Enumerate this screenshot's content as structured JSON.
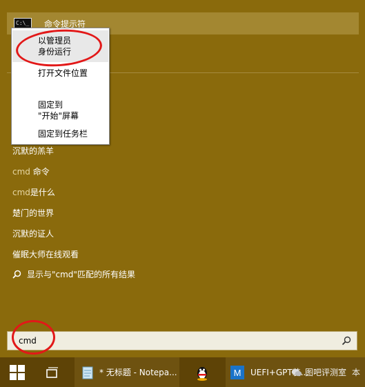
{
  "start_panel": {
    "top_result": {
      "label": "命令提示符",
      "icon_text": "C:\\_"
    },
    "results": [
      {
        "label": "沉默的羔羊"
      },
      {
        "prefix": "cmd",
        "label": " 命令"
      },
      {
        "prefix": "cmd",
        "label": "是什么"
      },
      {
        "label": "楚门的世界"
      },
      {
        "label": "沉默的证人"
      },
      {
        "label": "催眠大师在线观看"
      }
    ],
    "see_all": "显示与\"cmd\"匹配的所有结果"
  },
  "context_menu": {
    "items": [
      {
        "line1": "以管理员",
        "line2": "身份运行"
      },
      {
        "line1": "打开文件位置"
      },
      {
        "line1": "固定到",
        "line2": "\"开始\"屏幕"
      },
      {
        "line1": "固定到任务栏"
      }
    ]
  },
  "search": {
    "value": "cmd"
  },
  "taskbar": {
    "notepad_label": "* 无标题 - Notepa...",
    "browser_label": "UEFI+GPT装...",
    "watermark": "图吧评测室",
    "extra": "本"
  },
  "colors": {
    "panel": "#8a6a0c",
    "taskbar": "#5e4306",
    "annotation": "#e21818"
  }
}
